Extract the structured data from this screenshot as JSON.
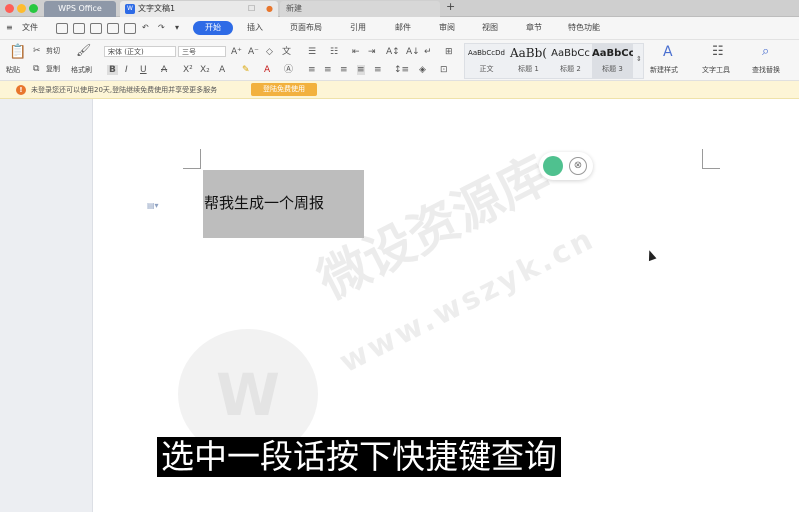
{
  "window": {
    "tabs": [
      {
        "label": "WPS Office"
      },
      {
        "label": "文字文稿1"
      },
      {
        "label": "新建"
      }
    ],
    "new_tab_icon": "+"
  },
  "menu": {
    "file": "文件",
    "tabs": [
      "开始",
      "插入",
      "页面布局",
      "引用",
      "审阅",
      "视图",
      "章节",
      "特色功能"
    ],
    "extra": [
      "邮件"
    ]
  },
  "ribbon": {
    "paste": "粘贴",
    "cut": "剪切",
    "copy": "复制",
    "format_painter": "格式刷",
    "font_name": "宋体 (正文)",
    "font_size": "三号",
    "styles": [
      {
        "preview": "AaBbCcDd",
        "label": "正文"
      },
      {
        "preview": "AaBb(",
        "label": "标题 1"
      },
      {
        "preview": "AaBbCc",
        "label": "标题 2"
      },
      {
        "preview": "AaBbCc",
        "label": "标题 3"
      }
    ],
    "new_style": "新建样式",
    "text_tools": "文字工具",
    "find_replace": "查找替换"
  },
  "notice": {
    "text": "未登录您还可以使用20天,登陆继续免费使用并享受更多服务",
    "button": "登陆免费使用"
  },
  "document": {
    "selected_text": "帮我生成一个周报"
  },
  "watermark": {
    "title": "微设资源库",
    "url": "www.wszyk.cn"
  },
  "caption": "选中一段话按下快捷键查询",
  "colors": {
    "accent": "#2e6be6",
    "notice_bg": "#fdf5d6",
    "notice_btn": "#f2b13e"
  }
}
